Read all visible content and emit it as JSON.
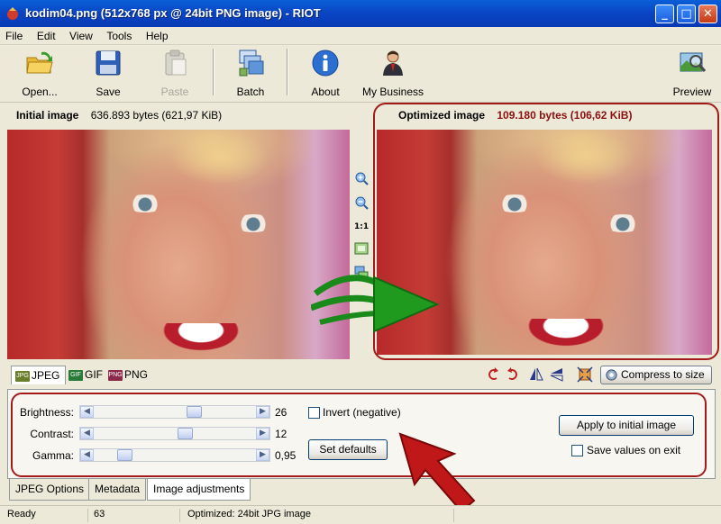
{
  "window": {
    "title": "kodim04.png (512x768 px @ 24bit PNG image) - RIOT",
    "minimize": "_",
    "maximize": "□",
    "close": "✕"
  },
  "menu": [
    "File",
    "Edit",
    "View",
    "Tools",
    "Help"
  ],
  "toolbar": {
    "open": "Open...",
    "save": "Save",
    "paste": "Paste",
    "batch": "Batch",
    "about": "About",
    "my_business": "My Business",
    "preview": "Preview"
  },
  "initial": {
    "label": "Initial image",
    "size": "636.893 bytes (621,97 KiB)"
  },
  "optimized": {
    "label": "Optimized image",
    "size": "109.180 bytes (106,62 KiB)"
  },
  "zoom": {
    "one_to_one": "1:1"
  },
  "formats": [
    {
      "badge": "JPG",
      "label": "JPEG",
      "color": "#6a7f2a"
    },
    {
      "badge": "GIF",
      "label": "GIF",
      "color": "#2a7a3a"
    },
    {
      "badge": "PNG",
      "label": "PNG",
      "color": "#8a2a4a"
    }
  ],
  "compress_label": "Compress to size",
  "adjust": {
    "brightness": {
      "label": "Brightness:",
      "value": "26",
      "level": 0.63
    },
    "contrast": {
      "label": "Contrast:",
      "value": "12",
      "level": 0.57
    },
    "gamma": {
      "label": "Gamma:",
      "value": "0,95",
      "level": 0.16
    },
    "invert_label": "Invert (negative)",
    "set_defaults": "Set defaults",
    "apply": "Apply to initial image",
    "save_values": "Save values on exit"
  },
  "bottom_tabs": [
    "JPEG Options",
    "Metadata",
    "Image adjustments"
  ],
  "status": {
    "state": "Ready",
    "quality": "63",
    "info": "Optimized: 24bit JPG image"
  }
}
